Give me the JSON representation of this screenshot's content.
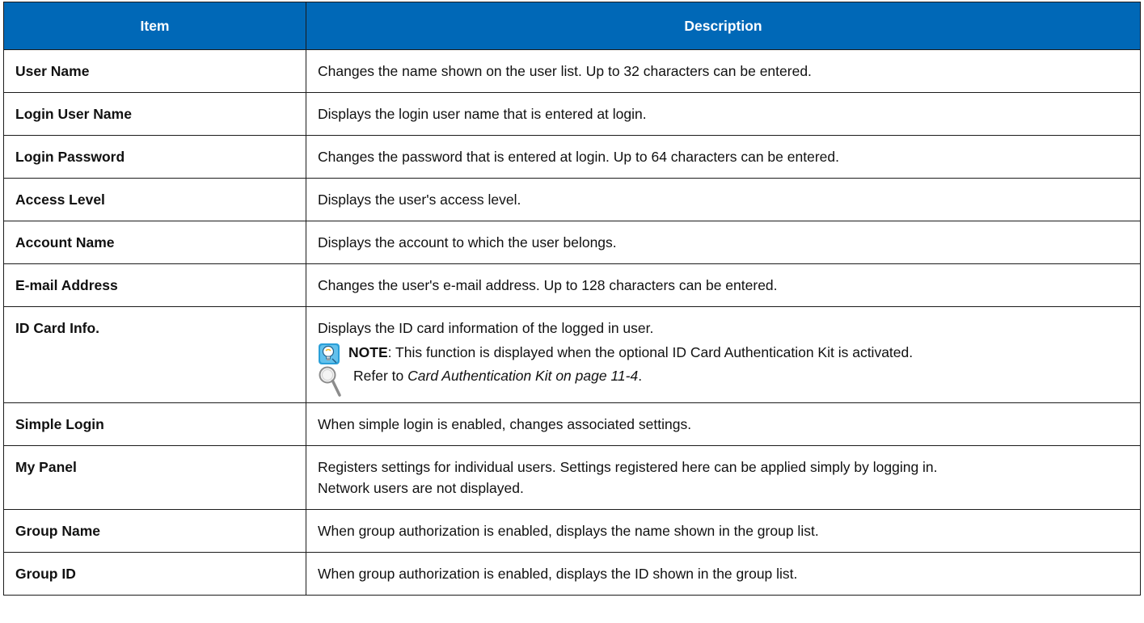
{
  "table": {
    "headers": {
      "item": "Item",
      "description": "Description"
    },
    "rows": [
      {
        "item": "User Name",
        "description": "Changes the name shown on the user list. Up to 32 characters can be entered."
      },
      {
        "item": "Login User Name",
        "description": "Displays the login user name that is entered at login."
      },
      {
        "item": "Login Password",
        "description": "Changes the password that is entered at login. Up to 64 characters can be entered."
      },
      {
        "item": "Access Level",
        "description": "Displays the user's access level."
      },
      {
        "item": "Account Name",
        "description": "Displays the account to which the user belongs."
      },
      {
        "item": "E-mail Address",
        "description": "Changes the user's e-mail address. Up to 128 characters can be entered."
      },
      {
        "item": "ID Card Info.",
        "description": "Displays the ID card information of the logged in user.",
        "note_label": "NOTE",
        "note_text": ": This function is displayed when the optional ID Card Authentication Kit is activated.",
        "ref_prefix": "Refer to ",
        "ref_link": "Card Authentication Kit on page 11-4",
        "ref_suffix": "."
      },
      {
        "item": "Simple Login",
        "description": "When simple login is enabled, changes associated settings."
      },
      {
        "item": "My Panel",
        "description": "Registers settings for individual users. Settings registered here can be applied simply by logging in. Network users are not displayed."
      },
      {
        "item": "Group Name",
        "description": "When group authorization is enabled, displays the name shown in the group list."
      },
      {
        "item": "Group ID",
        "description": "When group authorization is enabled, displays the ID shown in the group list."
      }
    ]
  },
  "icons": {
    "note": "note-lightbulb-icon",
    "reference": "magnifier-icon"
  },
  "colors": {
    "header_bg": "#0068b7",
    "header_text": "#ffffff",
    "border": "#1b1b1b"
  }
}
